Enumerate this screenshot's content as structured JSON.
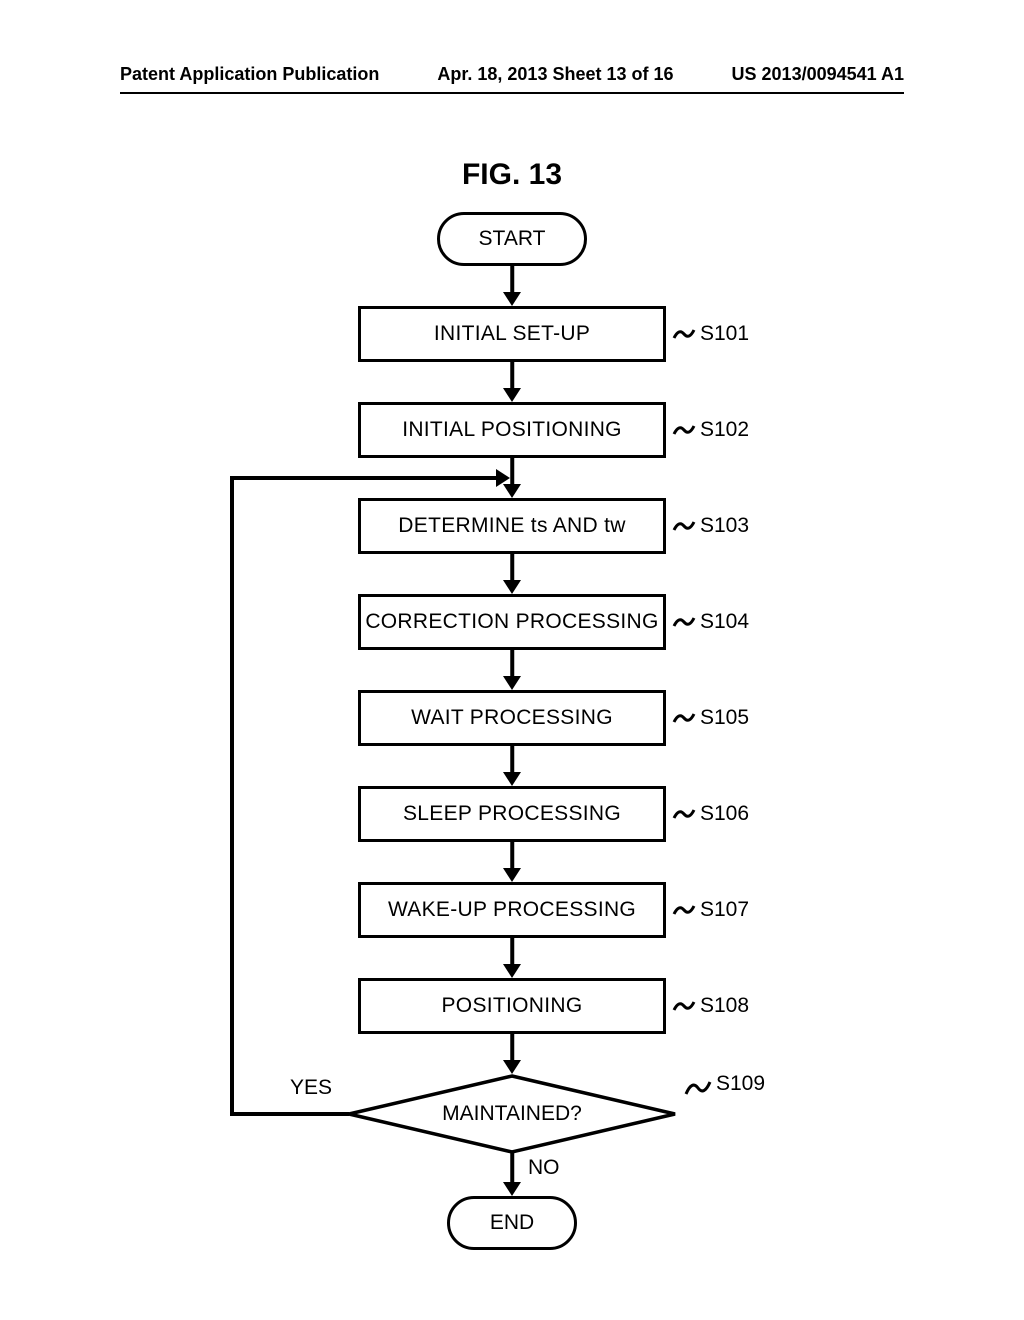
{
  "header": {
    "left": "Patent Application Publication",
    "center": "Apr. 18, 2013  Sheet 13 of 16",
    "right": "US 2013/0094541 A1"
  },
  "figure_title": "FIG. 13",
  "flow": {
    "start": "START",
    "end": "END",
    "steps": [
      {
        "id": "S101",
        "label": "INITIAL SET-UP"
      },
      {
        "id": "S102",
        "label": "INITIAL POSITIONING"
      },
      {
        "id": "S103",
        "label": "DETERMINE ts AND tw"
      },
      {
        "id": "S104",
        "label": "CORRECTION PROCESSING"
      },
      {
        "id": "S105",
        "label": "WAIT PROCESSING"
      },
      {
        "id": "S106",
        "label": "SLEEP PROCESSING"
      },
      {
        "id": "S107",
        "label": "WAKE-UP PROCESSING"
      },
      {
        "id": "S108",
        "label": "POSITIONING"
      }
    ],
    "decision": {
      "id": "S109",
      "label": "MAINTAINED?"
    },
    "branch_yes": "YES",
    "branch_no": "NO"
  },
  "chart_data": {
    "type": "flowchart",
    "nodes": [
      {
        "id": "start",
        "shape": "terminator",
        "label": "START"
      },
      {
        "id": "S101",
        "shape": "process",
        "label": "INITIAL SET-UP"
      },
      {
        "id": "S102",
        "shape": "process",
        "label": "INITIAL POSITIONING"
      },
      {
        "id": "S103",
        "shape": "process",
        "label": "DETERMINE ts AND tw"
      },
      {
        "id": "S104",
        "shape": "process",
        "label": "CORRECTION PROCESSING"
      },
      {
        "id": "S105",
        "shape": "process",
        "label": "WAIT PROCESSING"
      },
      {
        "id": "S106",
        "shape": "process",
        "label": "SLEEP PROCESSING"
      },
      {
        "id": "S107",
        "shape": "process",
        "label": "WAKE-UP PROCESSING"
      },
      {
        "id": "S108",
        "shape": "process",
        "label": "POSITIONING"
      },
      {
        "id": "S109",
        "shape": "decision",
        "label": "MAINTAINED?"
      },
      {
        "id": "end",
        "shape": "terminator",
        "label": "END"
      }
    ],
    "edges": [
      {
        "from": "start",
        "to": "S101"
      },
      {
        "from": "S101",
        "to": "S102"
      },
      {
        "from": "S102",
        "to": "S103"
      },
      {
        "from": "S103",
        "to": "S104"
      },
      {
        "from": "S104",
        "to": "S105"
      },
      {
        "from": "S105",
        "to": "S106"
      },
      {
        "from": "S106",
        "to": "S107"
      },
      {
        "from": "S107",
        "to": "S108"
      },
      {
        "from": "S108",
        "to": "S109"
      },
      {
        "from": "S109",
        "to": "S103",
        "label": "YES"
      },
      {
        "from": "S109",
        "to": "end",
        "label": "NO"
      }
    ]
  }
}
